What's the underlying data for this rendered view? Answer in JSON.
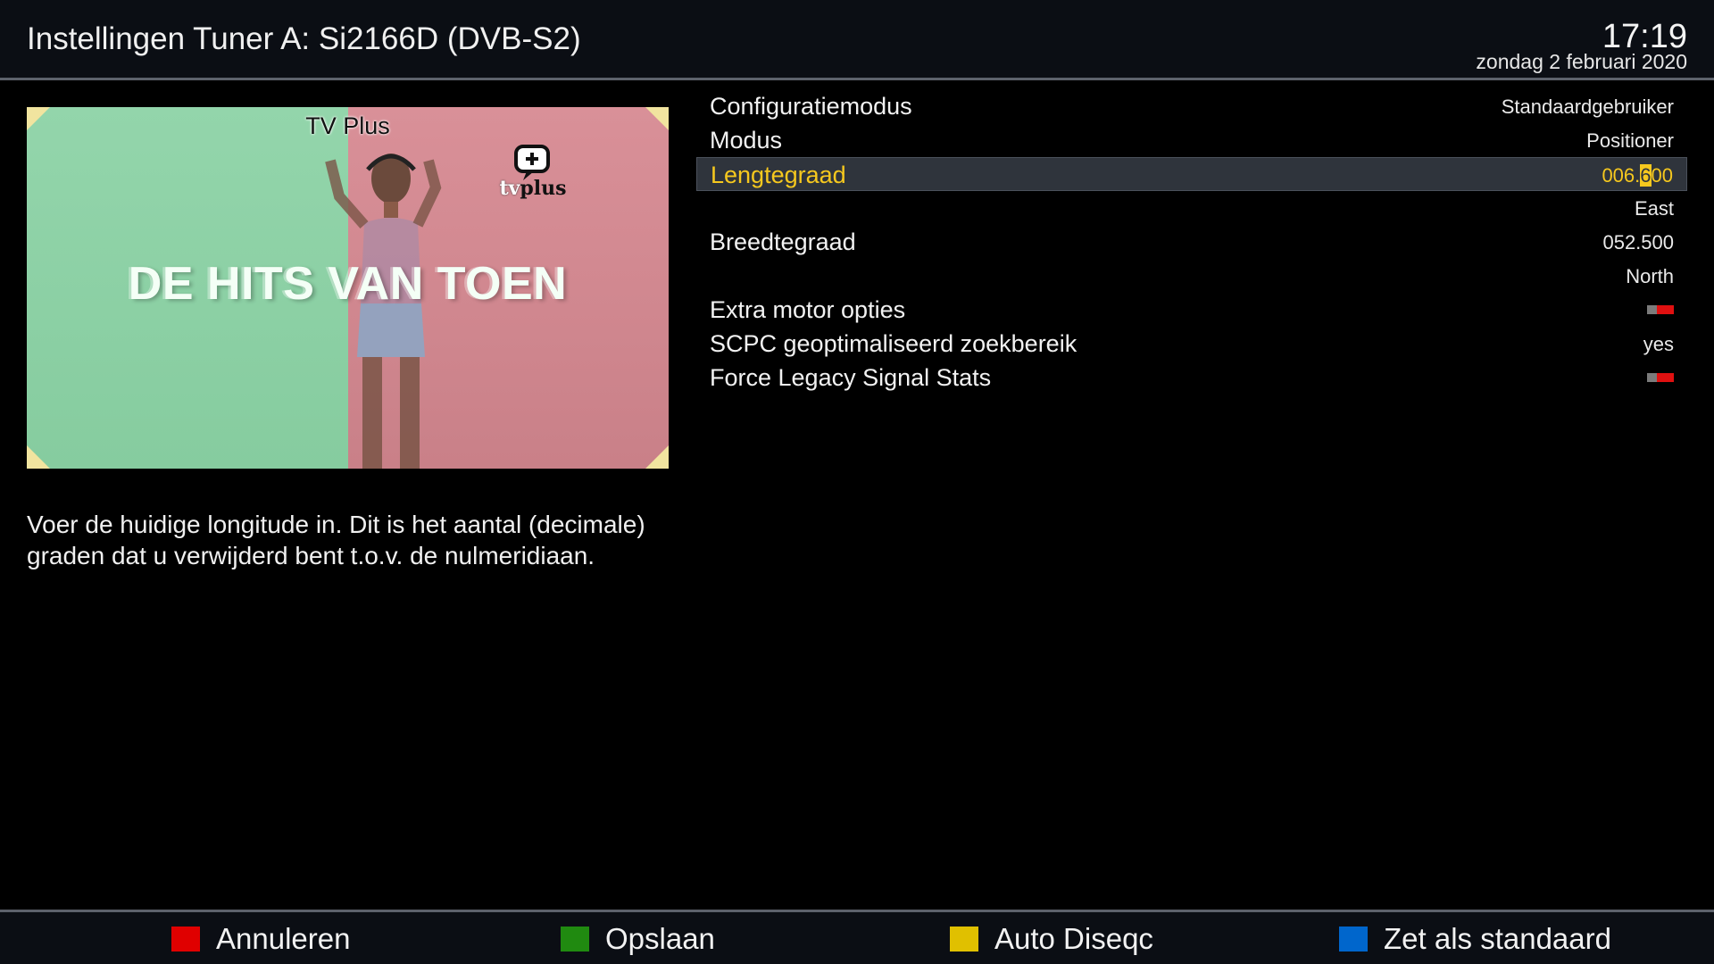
{
  "header": {
    "title": "Instellingen Tuner A: Si2166D (DVB-S2)",
    "time": "17:19",
    "date": "zondag 2 februari 2020"
  },
  "preview": {
    "channel_name": "TV Plus",
    "logo_prefix": "tv",
    "logo_suffix": "plus",
    "show_title": "DE HITS VAN TOEN"
  },
  "help_text": "Voer de huidige longitude in. Dit is het aantal (decimale) graden dat u verwijderd bent t.o.v. de nulmeridiaan.",
  "settings": [
    {
      "label": "Configuratiemodus",
      "value": "Standaardgebruiker"
    },
    {
      "label": "Modus",
      "value": "Positioner"
    },
    {
      "label": "Lengtegraad",
      "value_pre": "006.",
      "value_cursor": "6",
      "value_post": "00",
      "selected": true
    },
    {
      "label": "",
      "value": "East"
    },
    {
      "label": "Breedtegraad",
      "value": "052.500"
    },
    {
      "label": "",
      "value": "North"
    },
    {
      "label": "Extra motor opties",
      "toggle": "off"
    },
    {
      "label": "SCPC geoptimaliseerd zoekbereik",
      "value": "yes"
    },
    {
      "label": "Force Legacy Signal Stats",
      "toggle": "off"
    }
  ],
  "footer": {
    "red": "Annuleren",
    "green": "Opslaan",
    "yellow": "Auto Diseqc",
    "blue": "Zet als standaard"
  },
  "colors": {
    "red": "#e00000",
    "green": "#208a10",
    "yellow": "#e0c000",
    "blue": "#0066cc",
    "highlight": "#f6c81e"
  }
}
